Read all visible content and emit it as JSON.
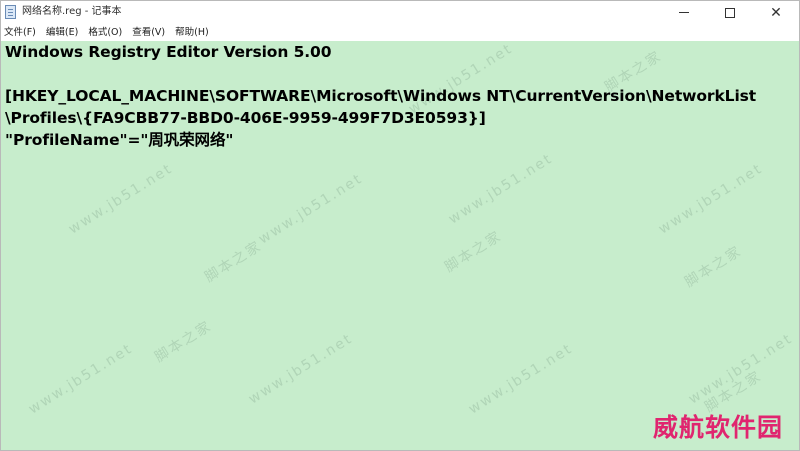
{
  "window": {
    "title": "网络名称.reg - 记事本",
    "controls": {
      "minimize_icon": "minimize-icon",
      "maximize_icon": "maximize-icon",
      "close_icon": "close-icon",
      "close_glyph": "✕"
    }
  },
  "menu": {
    "items": [
      "文件(F)",
      "编辑(E)",
      "格式(O)",
      "查看(V)",
      "帮助(H)"
    ]
  },
  "editor": {
    "background_color": "#c7edcc",
    "lines": [
      "Windows Registry Editor Version 5.00",
      "",
      "[HKEY_LOCAL_MACHINE\\SOFTWARE\\Microsoft\\Windows NT\\CurrentVersion\\NetworkList",
      "\\Profiles\\{FA9CBB77-BBD0-406E-9959-499F7D3E0593}]",
      "\"ProfileName\"=\"周巩荣网络\""
    ]
  },
  "watermarks": {
    "site": "www.jb51.net",
    "brand": "脚本之家"
  },
  "stamp": {
    "text": "威航软件园",
    "color": "#e0256f"
  }
}
